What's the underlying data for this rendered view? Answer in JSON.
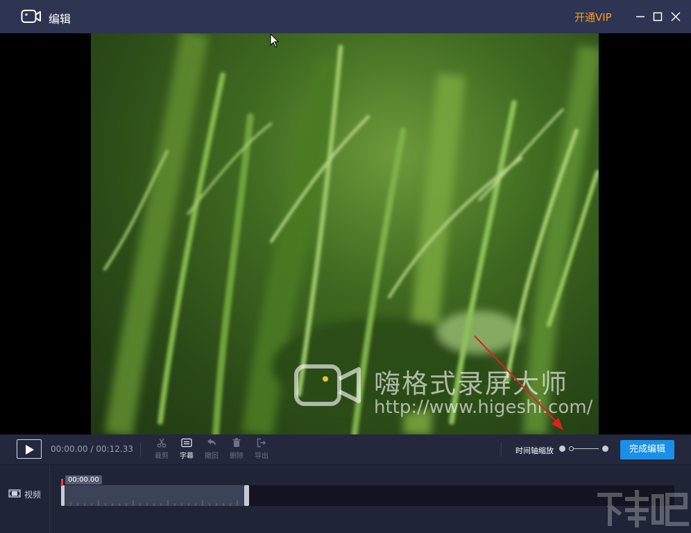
{
  "window": {
    "title": "编辑",
    "vip_label": "开通VIP"
  },
  "preview": {
    "watermark_name": "嗨格式录屏大师",
    "watermark_url": "http://www.higeshi.com/"
  },
  "toolbar": {
    "current_time": "00:00.00",
    "time_separator": " / ",
    "total_time": "00:12.33",
    "tools": [
      {
        "label": "裁剪",
        "icon": "scissors-icon",
        "enabled": false
      },
      {
        "label": "字幕",
        "icon": "subtitle-icon",
        "enabled": true
      },
      {
        "label": "撤回",
        "icon": "undo-icon",
        "enabled": false
      },
      {
        "label": "删除",
        "icon": "trash-icon",
        "enabled": false
      },
      {
        "label": "导出",
        "icon": "export-icon",
        "enabled": false
      }
    ],
    "zoom_label": "时间轴缩放",
    "done_label": "完成编辑"
  },
  "timeline": {
    "track_label": "视频",
    "playhead_time": "00:00.00"
  },
  "colors": {
    "titlebar": "#2e3552",
    "vip": "#ff9a1f",
    "primary_button": "#1a8fe8",
    "playhead": "#e8403a",
    "annotation_arrow": "#e02020"
  }
}
